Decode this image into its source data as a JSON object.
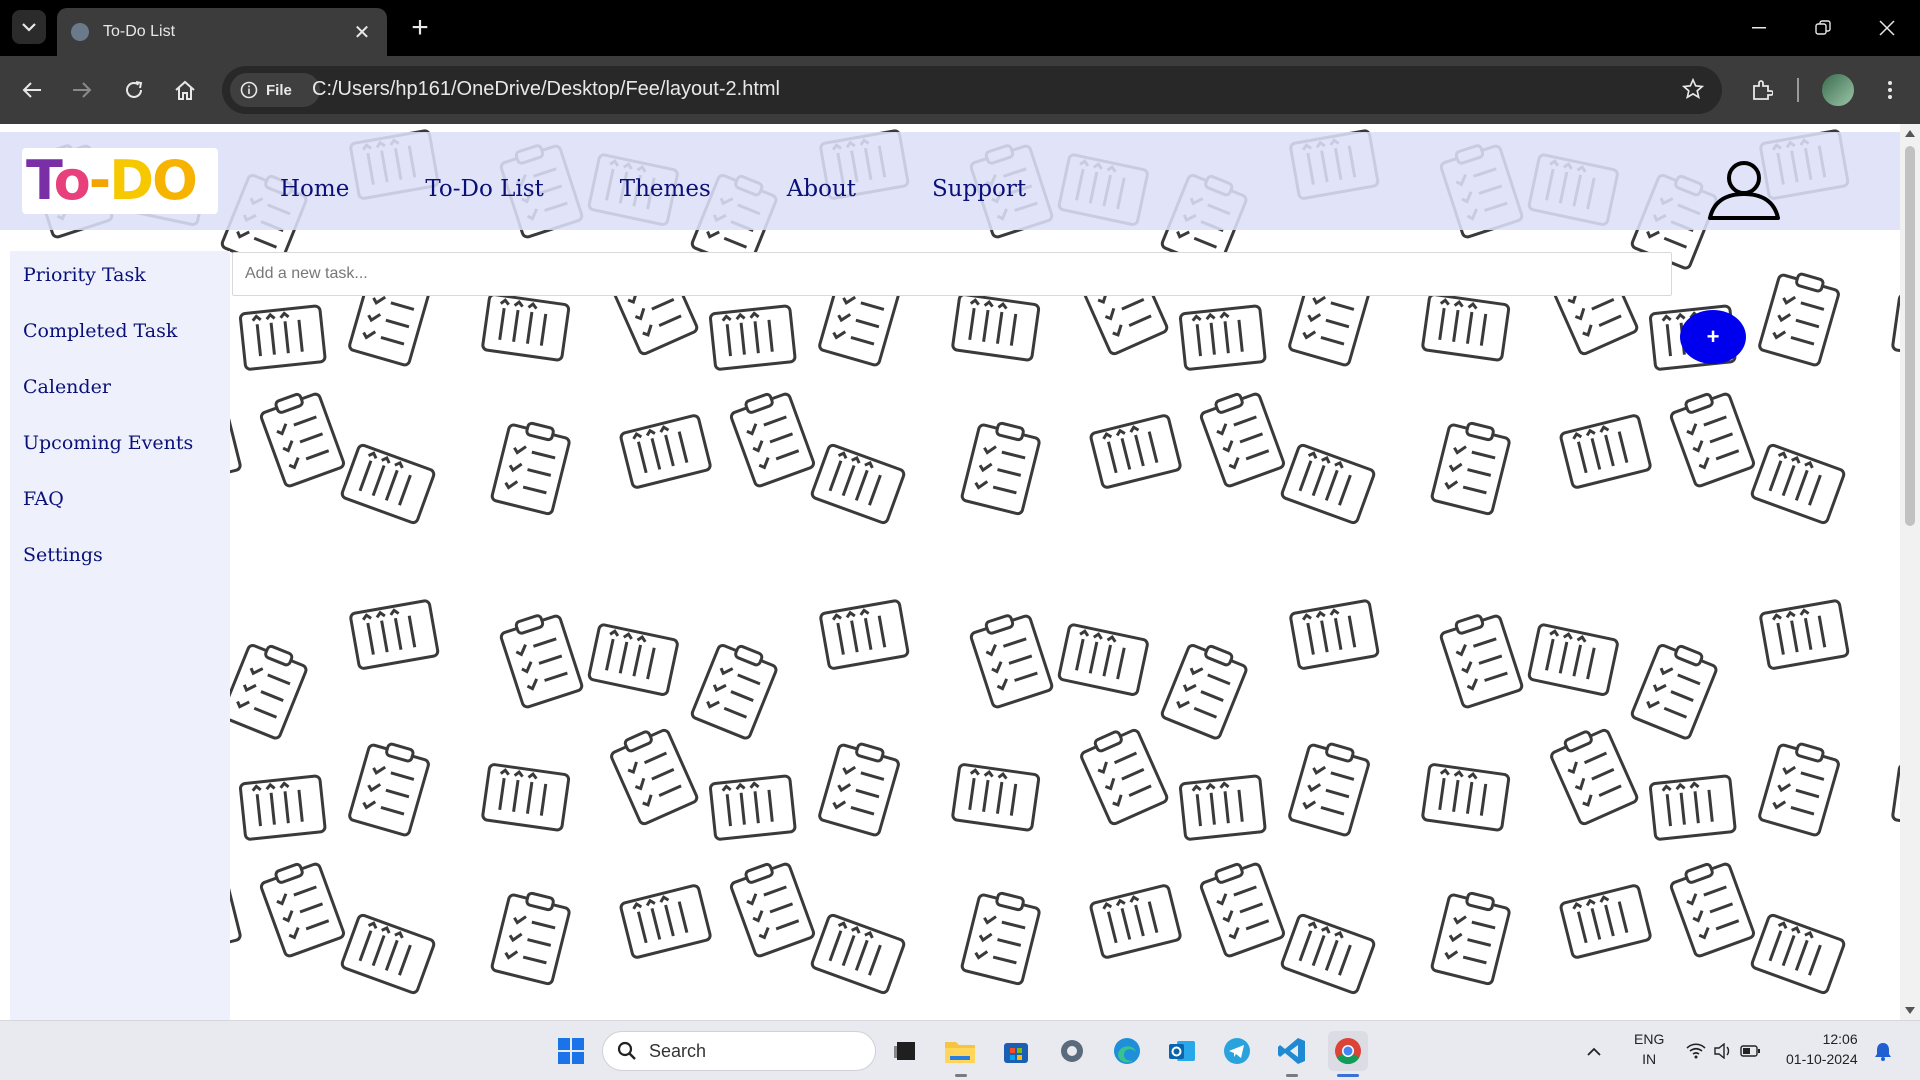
{
  "browser": {
    "tab_title": "To-Do List",
    "site_info_label": "File",
    "url": "C:/Users/hp161/OneDrive/Desktop/Fee/layout-2.html"
  },
  "page": {
    "logo_text": [
      "T",
      "o",
      "-",
      "D",
      "O"
    ],
    "nav": [
      "Home",
      "To-Do List",
      "Themes",
      "About",
      "Support"
    ],
    "sidebar": [
      "Priority Task",
      "Completed Task",
      "Calender",
      "Upcoming Events",
      "FAQ",
      "Settings"
    ],
    "task_input_placeholder": "Add a new task...",
    "add_button_label": "+",
    "colors": {
      "nav_bg": "#dde0f7",
      "sidebar_bg": "#eef0fb",
      "link": "#0a1078",
      "add_button": "#0000ee"
    }
  },
  "taskbar": {
    "search_label": "Search",
    "lang": "ENG",
    "region": "IN",
    "time": "12:06",
    "date": "01-10-2024"
  }
}
